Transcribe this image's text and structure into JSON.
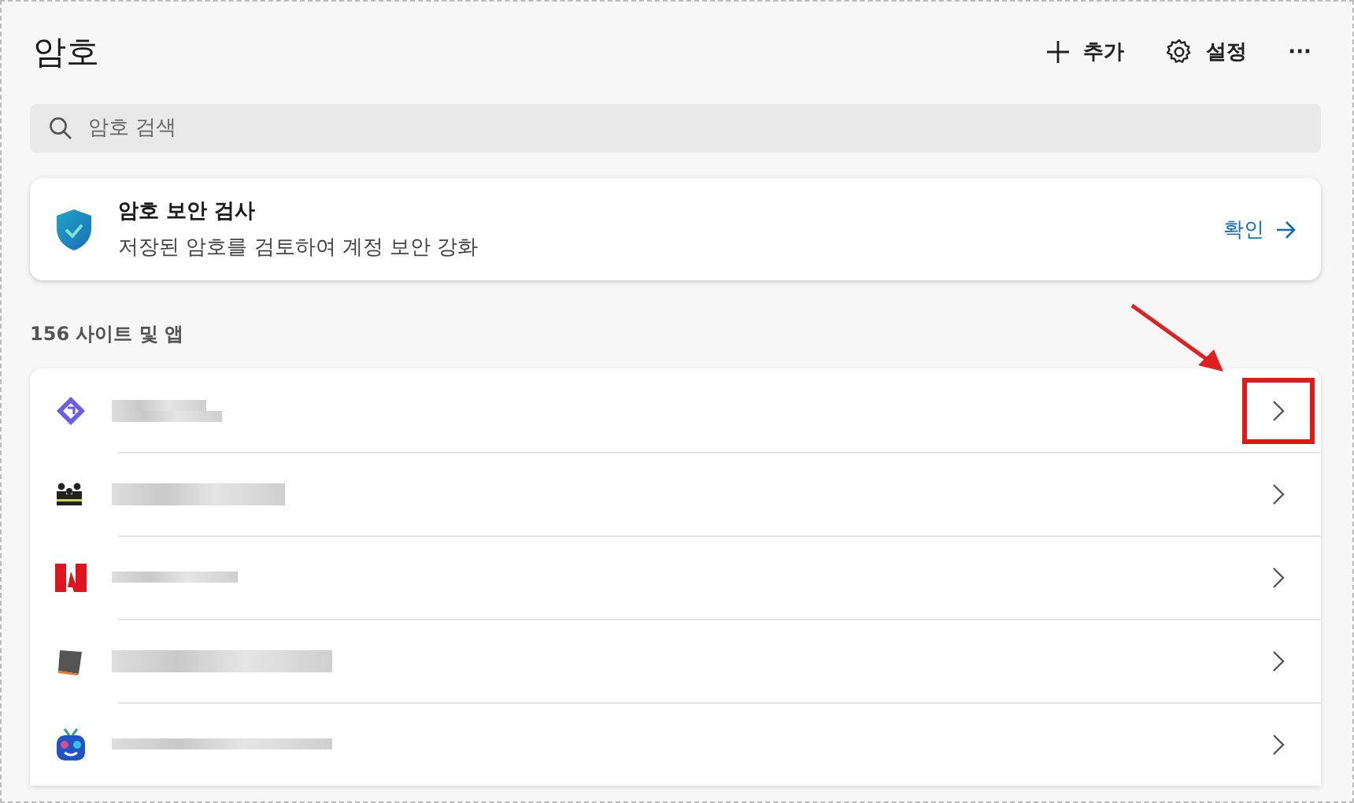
{
  "header": {
    "title": "암호",
    "actions": [
      {
        "kind": "add",
        "label": "추가"
      },
      {
        "kind": "settings",
        "label": "설정"
      },
      {
        "kind": "more",
        "label": "···"
      }
    ]
  },
  "search": {
    "placeholder": "암호 검색"
  },
  "security_card": {
    "title": "암호 보안 검사",
    "description": "저장된 암호를 검토하여 계정 보안 강화",
    "link": "확인"
  },
  "section": {
    "label": "156 사이트 및 앱"
  },
  "sites": [
    {
      "kind": "diamond",
      "highlighted": true
    },
    {
      "kind": "grid",
      "highlighted": false
    },
    {
      "kind": "triangle",
      "highlighted": false
    },
    {
      "kind": "tablet",
      "highlighted": false
    },
    {
      "kind": "robot",
      "highlighted": false
    }
  ]
}
